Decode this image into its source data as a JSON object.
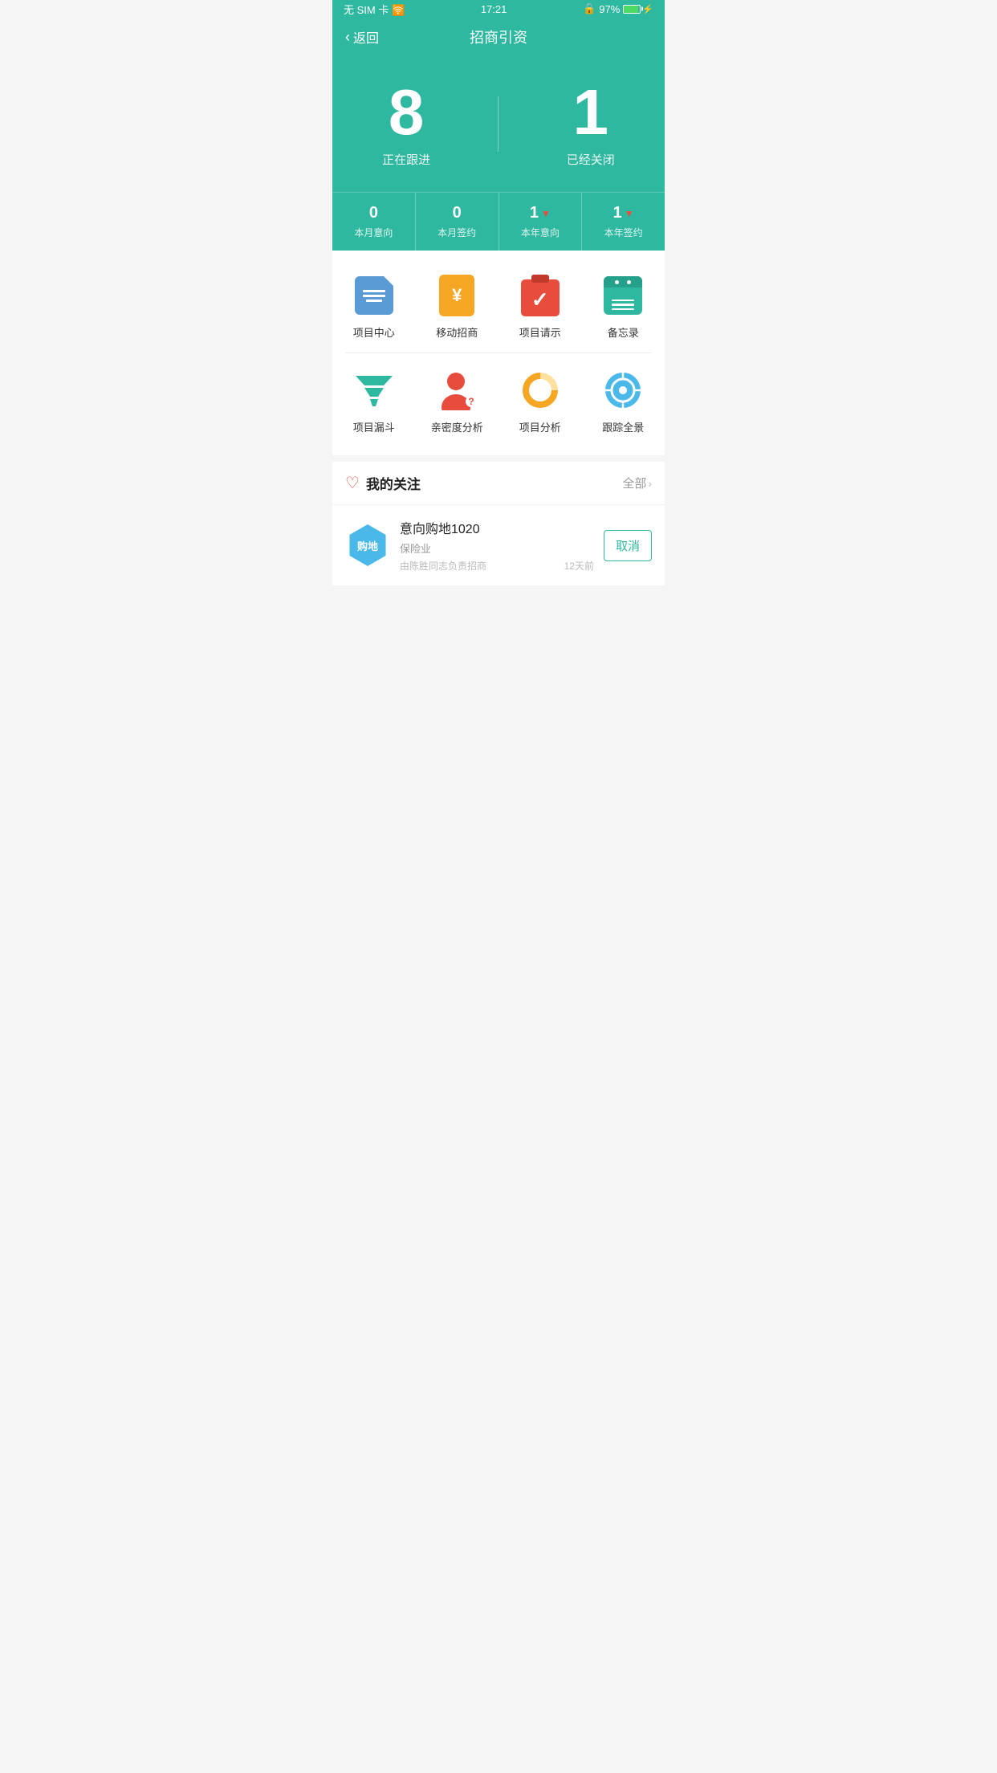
{
  "statusBar": {
    "left": "无 SIM 卡  🛜",
    "time": "17:21",
    "lock": "🔒",
    "battery": "97%"
  },
  "nav": {
    "back": "返回",
    "title": "招商引资"
  },
  "heroStats": {
    "tracking": "8",
    "trackingLabel": "正在跟进",
    "closed": "1",
    "closedLabel": "已经关闭"
  },
  "subStats": [
    {
      "value": "0",
      "label": "本月意向",
      "arrow": false
    },
    {
      "value": "0",
      "label": "本月签约",
      "arrow": false
    },
    {
      "value": "1",
      "label": "本年意向",
      "arrow": true
    },
    {
      "value": "1",
      "label": "本年签约",
      "arrow": true
    }
  ],
  "menuRow1": [
    {
      "label": "项目中心",
      "icon": "project-center"
    },
    {
      "label": "移动招商",
      "icon": "mobile-invest"
    },
    {
      "label": "项目请示",
      "icon": "project-req"
    },
    {
      "label": "备忘录",
      "icon": "notes"
    }
  ],
  "menuRow2": [
    {
      "label": "项目漏斗",
      "icon": "funnel"
    },
    {
      "label": "亲密度分析",
      "icon": "person"
    },
    {
      "label": "项目分析",
      "icon": "donut"
    },
    {
      "label": "跟踪全景",
      "icon": "location"
    }
  ],
  "attention": {
    "title": "我的关注",
    "more": "全部"
  },
  "listItems": [
    {
      "badge": "购地",
      "title": "意向购地1020",
      "subtitle": "保险业",
      "meta": "由陈胜同志负责招商",
      "time": "12天前",
      "action": "取消"
    }
  ]
}
